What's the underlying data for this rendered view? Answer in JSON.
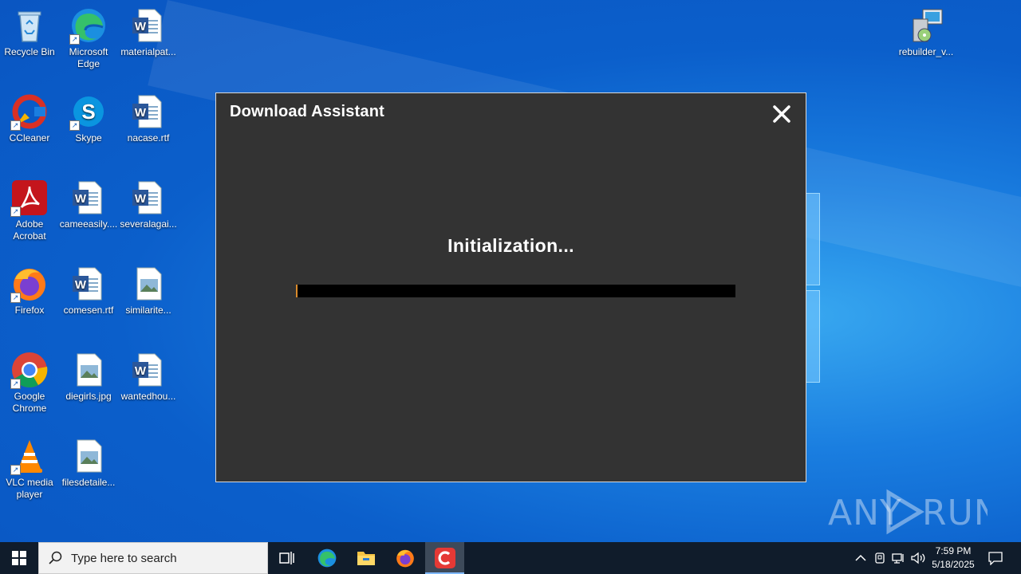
{
  "desktop": {
    "icons": [
      {
        "label": "Recycle Bin",
        "icon": "recycle-bin-icon"
      },
      {
        "label": "Microsoft Edge",
        "icon": "edge-icon"
      },
      {
        "label": "materialpat...",
        "icon": "word-doc-icon"
      },
      {
        "label": "CCleaner",
        "icon": "ccleaner-icon"
      },
      {
        "label": "Skype",
        "icon": "skype-icon"
      },
      {
        "label": "nacase.rtf",
        "icon": "word-doc-icon"
      },
      {
        "label": "Adobe Acrobat",
        "icon": "acrobat-icon"
      },
      {
        "label": "cameeasily....",
        "icon": "word-doc-icon"
      },
      {
        "label": "severalagai...",
        "icon": "word-doc-icon"
      },
      {
        "label": "Firefox",
        "icon": "firefox-icon"
      },
      {
        "label": "comesen.rtf",
        "icon": "word-doc-icon"
      },
      {
        "label": "similarite...",
        "icon": "image-file-icon"
      },
      {
        "label": "Google Chrome",
        "icon": "chrome-icon"
      },
      {
        "label": "diegirls.jpg",
        "icon": "image-file-icon"
      },
      {
        "label": "wantedhou...",
        "icon": "word-doc-icon"
      },
      {
        "label": "VLC media player",
        "icon": "vlc-icon"
      },
      {
        "label": "filesdetaile...",
        "icon": "image-file-icon"
      },
      {
        "label": "rebuilder_v...",
        "icon": "installer-icon"
      }
    ]
  },
  "dialog": {
    "title": "Download Assistant",
    "status": "Initialization...",
    "progress_fraction": 0.004,
    "accent_color": "#d98a2b",
    "background_color": "#333333"
  },
  "watermark": {
    "text": "ANY RUN"
  },
  "taskbar": {
    "search_placeholder": "Type here to search",
    "pinned": [
      "start-icon",
      "task-view-icon",
      "edge-icon",
      "file-explorer-icon",
      "firefox-icon",
      "ccleaner-icon"
    ],
    "active_app": "ccleaner-icon",
    "clock": {
      "time": "7:59 PM",
      "date": "5/18/2025"
    }
  }
}
